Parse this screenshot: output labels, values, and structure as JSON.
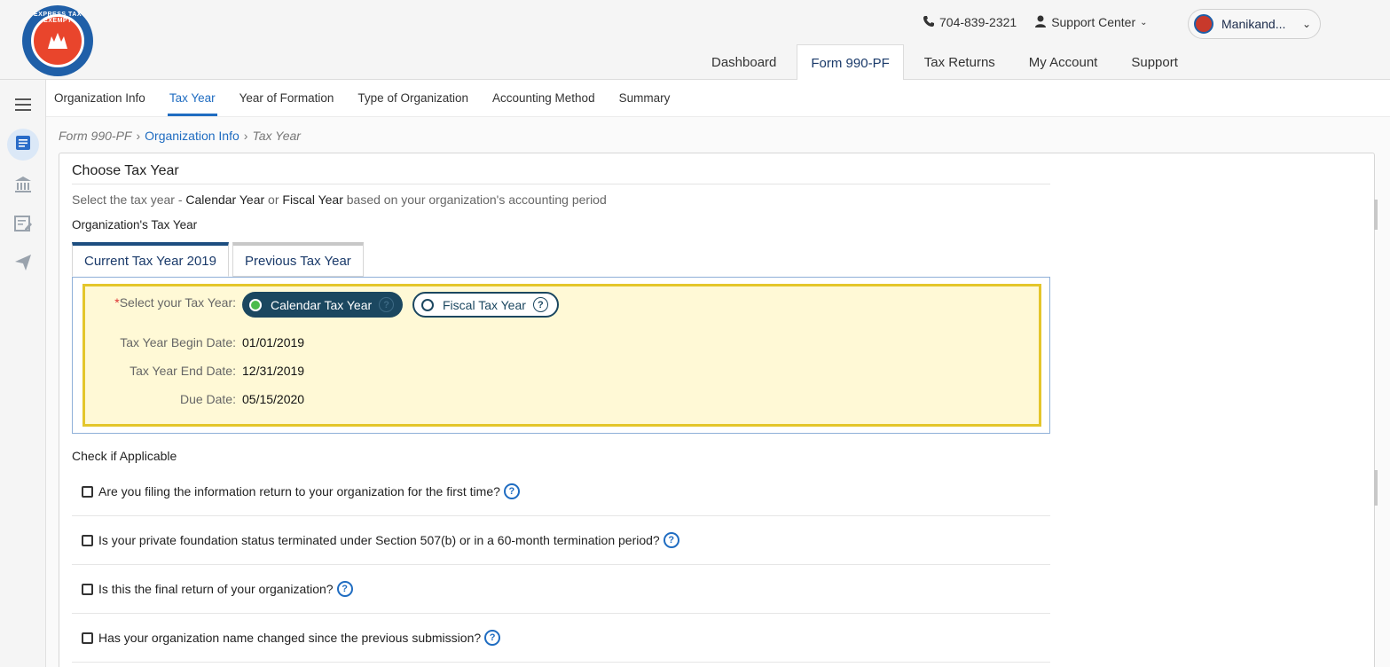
{
  "header": {
    "logo_text": "EXPRESS TAX EXEMPT",
    "phone": "704-839-2321",
    "support_center": "Support Center",
    "user_name": "Manikand...",
    "nav": [
      {
        "label": "Dashboard"
      },
      {
        "label": "Form 990-PF"
      },
      {
        "label": "Tax Returns"
      },
      {
        "label": "My Account"
      },
      {
        "label": "Support"
      }
    ]
  },
  "subnav": [
    {
      "label": "Organization Info"
    },
    {
      "label": "Tax Year"
    },
    {
      "label": "Year of Formation"
    },
    {
      "label": "Type of Organization"
    },
    {
      "label": "Accounting Method"
    },
    {
      "label": "Summary"
    }
  ],
  "breadcrumb": {
    "root": "Form 990-PF",
    "link": "Organization Info",
    "current": "Tax Year"
  },
  "panel": {
    "title": "Choose Tax Year",
    "desc_prefix": "Select the tax year - ",
    "desc_calendar": "Calendar Year",
    "desc_or": " or ",
    "desc_fiscal": "Fiscal Year",
    "desc_suffix": " based on your organization's accounting period",
    "org_tax_year_label": "Organization's Tax Year",
    "tabs": [
      {
        "label": "Current Tax Year 2019"
      },
      {
        "label": "Previous Tax Year"
      }
    ],
    "select_label": "Select your Tax Year:",
    "calendar_option": "Calendar Tax Year",
    "fiscal_option": "Fiscal Tax Year",
    "begin_label": "Tax Year Begin Date:",
    "begin_value": "01/01/2019",
    "end_label": "Tax Year End Date:",
    "end_value": "12/31/2019",
    "due_label": "Due Date:",
    "due_value": "05/15/2020",
    "check_title": "Check if Applicable",
    "checks": [
      {
        "text": "Are you filing the information return to your organization for the first time?"
      },
      {
        "text": "Is your private foundation status terminated under Section 507(b) or in a 60-month termination period?"
      },
      {
        "text": "Is this the final return of your organization?"
      },
      {
        "text": "Has your organization name changed since the previous submission?"
      }
    ]
  },
  "colors": {
    "accent": "#1f6cc1",
    "dark_pill": "#1b4760",
    "highlight_bg": "#fff9d6",
    "highlight_border": "#e4c62b"
  }
}
